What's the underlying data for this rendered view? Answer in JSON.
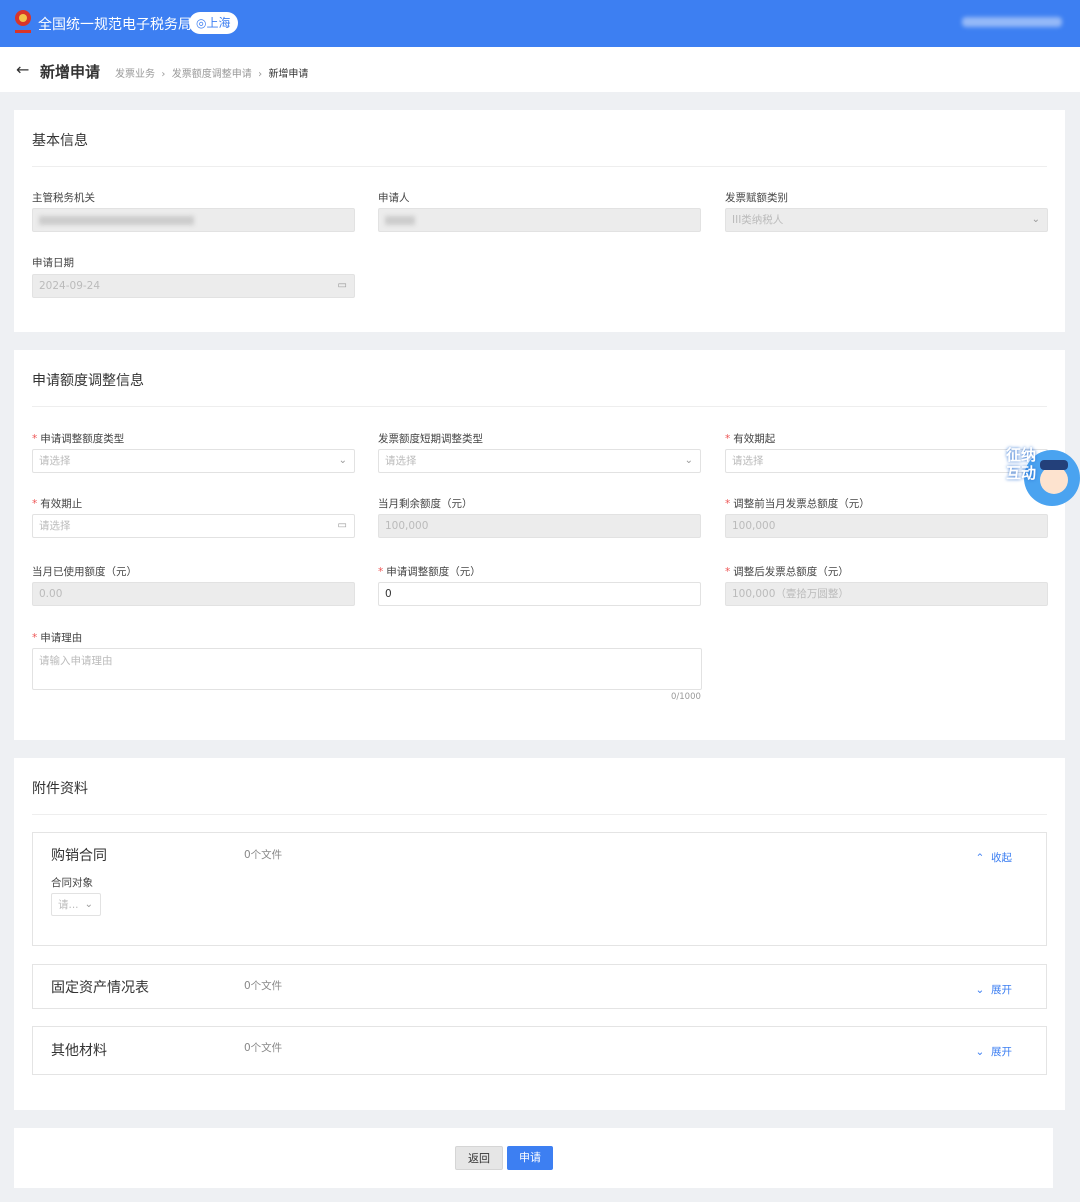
{
  "header": {
    "app_title": "全国统一规范电子税务局",
    "location": "上海"
  },
  "page": {
    "title": "新增申请",
    "breadcrumb": [
      "发票业务",
      "发票额度调整申请",
      "新增申请"
    ]
  },
  "basic": {
    "title": "基本信息",
    "fields": [
      {
        "label": "主管税务机关",
        "value": ""
      },
      {
        "label": "申请人",
        "value": ""
      },
      {
        "label": "发票赋额类别",
        "value": "III类纳税人"
      },
      {
        "label": "申请日期",
        "value": "2024-09-24"
      }
    ]
  },
  "adjust": {
    "title": "申请额度调整信息",
    "fields": [
      {
        "label": "申请调整额度类型",
        "required": true,
        "placeholder": "请选择"
      },
      {
        "label": "发票额度短期调整类型",
        "required": false,
        "placeholder": "请选择"
      },
      {
        "label": "有效期起",
        "required": true,
        "placeholder": "请选择"
      },
      {
        "label": "有效期止",
        "required": true,
        "placeholder": "请选择"
      },
      {
        "label": "当月剩余额度（元）",
        "required": false,
        "value": "100,000"
      },
      {
        "label": "调整前当月发票总额度（元）",
        "required": true,
        "value": "100,000"
      },
      {
        "label": "当月已使用额度（元）",
        "required": false,
        "value": "0.00"
      },
      {
        "label": "申请调整额度（元）",
        "required": true,
        "value": "0"
      },
      {
        "label": "调整后发票总额度（元）",
        "required": true,
        "value": "100,000（壹拾万圆整）"
      }
    ],
    "reason": {
      "label": "申请理由",
      "placeholder": "请输入申请理由",
      "counter": "0/1000"
    }
  },
  "attachments": {
    "title": "附件资料",
    "sections": [
      {
        "title": "购销合同",
        "count": "0个文件",
        "toggle": "收起",
        "sub_label": "合同对象",
        "sub_placeholder": "请..."
      },
      {
        "title": "固定资产情况表",
        "count": "0个文件",
        "toggle": "展开"
      },
      {
        "title": "其他材料",
        "count": "0个文件",
        "toggle": "展开"
      }
    ]
  },
  "footer": {
    "back": "返回",
    "submit": "申请"
  },
  "mascot": {
    "text": "征纳互动"
  },
  "colors": {
    "primary": "#3d7ff2",
    "required": "#e55555"
  }
}
